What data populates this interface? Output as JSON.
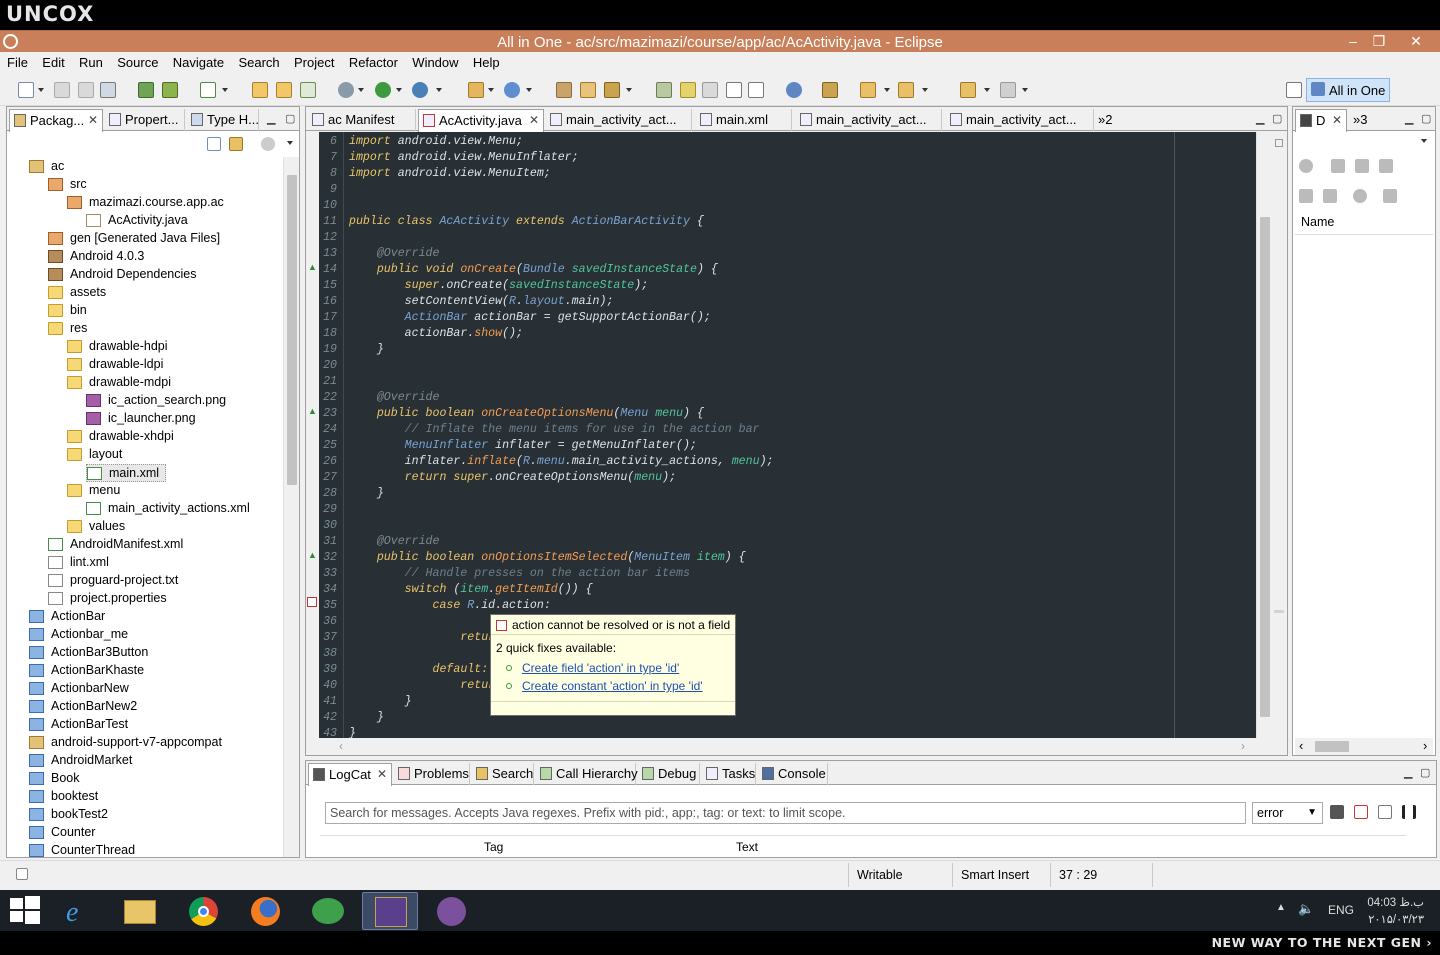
{
  "top_bar": {
    "logo": "UNCOX"
  },
  "window": {
    "title": "All in One - ac/src/mazimazi/course/app/ac/AcActivity.java - Eclipse",
    "controls": {
      "minimize": "–",
      "restore": "❐",
      "close": "✕"
    }
  },
  "menu": [
    "File",
    "Edit",
    "Run",
    "Source",
    "Navigate",
    "Search",
    "Project",
    "Refactor",
    "Window",
    "Help"
  ],
  "perspective": {
    "label": "All in One"
  },
  "left_panel": {
    "tabs": [
      {
        "label": "Packag..."
      },
      {
        "label": "Propert..."
      },
      {
        "label": "Type H..."
      }
    ],
    "tree": [
      {
        "label": "ac",
        "icon": "project"
      },
      {
        "label": "src",
        "icon": "package-folder"
      },
      {
        "label": "mazimazi.course.app.ac",
        "icon": "package"
      },
      {
        "label": "AcActivity.java",
        "icon": "java-file"
      },
      {
        "label": "gen [Generated Java Files]",
        "icon": "package-folder"
      },
      {
        "label": "Android 4.0.3",
        "icon": "library"
      },
      {
        "label": "Android Dependencies",
        "icon": "library"
      },
      {
        "label": "assets",
        "icon": "folder"
      },
      {
        "label": "bin",
        "icon": "folder"
      },
      {
        "label": "res",
        "icon": "folder"
      },
      {
        "label": "drawable-hdpi",
        "icon": "folder"
      },
      {
        "label": "drawable-ldpi",
        "icon": "folder"
      },
      {
        "label": "drawable-mdpi",
        "icon": "folder"
      },
      {
        "label": "ic_action_search.png",
        "icon": "png-file"
      },
      {
        "label": "ic_launcher.png",
        "icon": "png-file"
      },
      {
        "label": "drawable-xhdpi",
        "icon": "folder"
      },
      {
        "label": "layout",
        "icon": "folder"
      },
      {
        "label": "main.xml",
        "icon": "xml-file"
      },
      {
        "label": "menu",
        "icon": "folder"
      },
      {
        "label": "main_activity_actions.xml",
        "icon": "xml-file"
      },
      {
        "label": "values",
        "icon": "folder"
      },
      {
        "label": "AndroidManifest.xml",
        "icon": "xml-file"
      },
      {
        "label": "lint.xml",
        "icon": "file"
      },
      {
        "label": "proguard-project.txt",
        "icon": "file"
      },
      {
        "label": "project.properties",
        "icon": "file"
      },
      {
        "label": "ActionBar",
        "icon": "closed-project"
      },
      {
        "label": "Actionbar_me",
        "icon": "closed-project"
      },
      {
        "label": "ActionBar3Button",
        "icon": "closed-project"
      },
      {
        "label": "ActionBarKhaste",
        "icon": "closed-project"
      },
      {
        "label": "ActionbarNew",
        "icon": "closed-project"
      },
      {
        "label": "ActionBarNew2",
        "icon": "closed-project"
      },
      {
        "label": "ActionBarTest",
        "icon": "closed-project"
      },
      {
        "label": "android-support-v7-appcompat",
        "icon": "project"
      },
      {
        "label": "AndroidMarket",
        "icon": "closed-project"
      },
      {
        "label": "Book",
        "icon": "closed-project"
      },
      {
        "label": "booktest",
        "icon": "closed-project"
      },
      {
        "label": "bookTest2",
        "icon": "closed-project"
      },
      {
        "label": "Counter",
        "icon": "closed-project"
      },
      {
        "label": "CounterThread",
        "icon": "closed-project"
      }
    ]
  },
  "editor": {
    "tabs": [
      {
        "label": "ac Manifest"
      },
      {
        "label": "AcActivity.java"
      },
      {
        "label": "main_activity_act..."
      },
      {
        "label": "main.xml"
      },
      {
        "label": "main_activity_act..."
      },
      {
        "label": "main_activity_act..."
      }
    ],
    "overflow": "»2",
    "lines": [
      {
        "n": "6",
        "segs": [
          [
            "kw",
            "import"
          ],
          [
            "p",
            " android.view.Menu;"
          ]
        ]
      },
      {
        "n": "7",
        "segs": [
          [
            "kw",
            "import"
          ],
          [
            "p",
            " android.view.MenuInflater;"
          ]
        ]
      },
      {
        "n": "8",
        "segs": [
          [
            "kw",
            "import"
          ],
          [
            "p",
            " android.view.MenuItem;"
          ]
        ]
      },
      {
        "n": "9",
        "segs": []
      },
      {
        "n": "10",
        "segs": []
      },
      {
        "n": "11",
        "segs": [
          [
            "kw",
            "public class"
          ],
          [
            "p",
            " "
          ],
          [
            "ty",
            "AcActivity"
          ],
          [
            "p",
            " "
          ],
          [
            "kw",
            "extends"
          ],
          [
            "p",
            " "
          ],
          [
            "ty",
            "ActionBarActivity"
          ],
          [
            "p",
            " {"
          ]
        ]
      },
      {
        "n": "12",
        "segs": []
      },
      {
        "n": "13",
        "segs": [
          [
            "an",
            "    @Override"
          ]
        ]
      },
      {
        "n": "14",
        "segs": [
          [
            "kw",
            "    public void"
          ],
          [
            "p",
            " "
          ],
          [
            "fn",
            "onCreate"
          ],
          [
            "p",
            "("
          ],
          [
            "ty",
            "Bundle"
          ],
          [
            "p",
            " "
          ],
          [
            "pa",
            "savedInstanceState"
          ],
          [
            "p",
            ") {"
          ]
        ]
      },
      {
        "n": "15",
        "segs": [
          [
            "kw",
            "        super"
          ],
          [
            "p",
            ".onCreate("
          ],
          [
            "pa",
            "savedInstanceState"
          ],
          [
            "p",
            ");"
          ]
        ]
      },
      {
        "n": "16",
        "segs": [
          [
            "p",
            "        setContentView("
          ],
          [
            "ty",
            "R"
          ],
          [
            "p",
            "."
          ],
          [
            "ty",
            "layout"
          ],
          [
            "p",
            ".main);"
          ]
        ]
      },
      {
        "n": "17",
        "segs": [
          [
            "ty",
            "        ActionBar"
          ],
          [
            "p",
            " actionBar = getSupportActionBar();"
          ]
        ]
      },
      {
        "n": "18",
        "segs": [
          [
            "p",
            "        actionBar."
          ],
          [
            "fn",
            "show"
          ],
          [
            "p",
            "();"
          ]
        ]
      },
      {
        "n": "19",
        "segs": [
          [
            "p",
            "    }"
          ]
        ]
      },
      {
        "n": "20",
        "segs": []
      },
      {
        "n": "21",
        "segs": []
      },
      {
        "n": "22",
        "segs": [
          [
            "an",
            "    @Override"
          ]
        ]
      },
      {
        "n": "23",
        "segs": [
          [
            "kw",
            "    public boolean"
          ],
          [
            "p",
            " "
          ],
          [
            "fn",
            "onCreateOptionsMenu"
          ],
          [
            "p",
            "("
          ],
          [
            "ty",
            "Menu"
          ],
          [
            "p",
            " "
          ],
          [
            "pa",
            "menu"
          ],
          [
            "p",
            ") {"
          ]
        ]
      },
      {
        "n": "24",
        "segs": [
          [
            "cm",
            "        // Inflate the menu items for use in the action bar"
          ]
        ]
      },
      {
        "n": "25",
        "segs": [
          [
            "ty",
            "        MenuInflater"
          ],
          [
            "p",
            " inflater = getMenuInflater();"
          ]
        ]
      },
      {
        "n": "26",
        "segs": [
          [
            "p",
            "        inflater."
          ],
          [
            "fn",
            "inflate"
          ],
          [
            "p",
            "("
          ],
          [
            "ty",
            "R"
          ],
          [
            "p",
            "."
          ],
          [
            "ty",
            "menu"
          ],
          [
            "p",
            ".main_activity_actions, "
          ],
          [
            "pa",
            "menu"
          ],
          [
            "p",
            ");"
          ]
        ]
      },
      {
        "n": "27",
        "segs": [
          [
            "kw",
            "        return super"
          ],
          [
            "p",
            ".onCreateOptionsMenu("
          ],
          [
            "pa",
            "menu"
          ],
          [
            "p",
            ");"
          ]
        ]
      },
      {
        "n": "28",
        "segs": [
          [
            "p",
            "    }"
          ]
        ]
      },
      {
        "n": "29",
        "segs": []
      },
      {
        "n": "30",
        "segs": []
      },
      {
        "n": "31",
        "segs": [
          [
            "an",
            "    @Override"
          ]
        ]
      },
      {
        "n": "32",
        "segs": [
          [
            "kw",
            "    public boolean"
          ],
          [
            "p",
            " "
          ],
          [
            "fn",
            "onOptionsItemSelected"
          ],
          [
            "p",
            "("
          ],
          [
            "ty",
            "MenuItem"
          ],
          [
            "p",
            " "
          ],
          [
            "pa",
            "item"
          ],
          [
            "p",
            ") {"
          ]
        ]
      },
      {
        "n": "33",
        "segs": [
          [
            "cm",
            "        // Handle presses on the action bar items"
          ]
        ]
      },
      {
        "n": "34",
        "segs": [
          [
            "kw",
            "        switch"
          ],
          [
            "p",
            " ("
          ],
          [
            "pa",
            "item"
          ],
          [
            "p",
            "."
          ],
          [
            "fn",
            "getItemId"
          ],
          [
            "p",
            "()) {"
          ]
        ]
      },
      {
        "n": "35",
        "segs": [
          [
            "kw",
            "            case"
          ],
          [
            "p",
            " "
          ],
          [
            "ty",
            "R"
          ],
          [
            "p",
            ".id.action:"
          ]
        ]
      },
      {
        "n": "36",
        "segs": []
      },
      {
        "n": "37",
        "segs": [
          [
            "kw",
            "                return"
          ]
        ]
      },
      {
        "n": "38",
        "segs": []
      },
      {
        "n": "39",
        "segs": [
          [
            "kw",
            "            default:"
          ]
        ]
      },
      {
        "n": "40",
        "segs": [
          [
            "kw",
            "                return"
          ]
        ]
      },
      {
        "n": "41",
        "segs": [
          [
            "p",
            "        }"
          ]
        ]
      },
      {
        "n": "42",
        "segs": [
          [
            "p",
            "    }"
          ]
        ]
      },
      {
        "n": "43",
        "segs": [
          [
            "p",
            "}"
          ]
        ]
      }
    ]
  },
  "quickfix": {
    "error": "action cannot be resolved or is not a field",
    "available": "2 quick fixes available:",
    "fixes": [
      "Create field 'action' in type 'id'",
      "Create constant 'action' in type 'id'"
    ]
  },
  "right_panel": {
    "tab": "D",
    "overflow": "»3",
    "column": "Name"
  },
  "bottom_panel": {
    "tabs": [
      "LogCat",
      "Problems",
      "Search",
      "Call Hierarchy",
      "Debug",
      "Tasks",
      "Console"
    ],
    "search_placeholder": "Search for messages. Accepts Java regexes. Prefix with pid:, app:, tag: or text: to limit scope.",
    "level": "error",
    "columns": [
      "Tag",
      "Text"
    ]
  },
  "status": {
    "writable": "Writable",
    "insert_mode": "Smart Insert",
    "position": "37 : 29"
  },
  "taskbar": {
    "lang": "ENG",
    "time": "04:03 ب.ظ",
    "date": "۲۰۱۵/۰۳/۲۳"
  },
  "tagline": "NEW WAY TO THE NEXT GEN ›"
}
